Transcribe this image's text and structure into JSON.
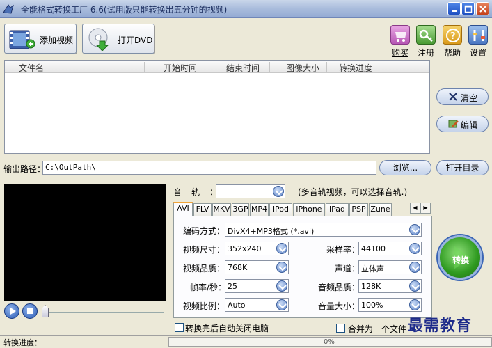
{
  "window": {
    "title": "全能格式转换工厂 6.6(试用版只能转换出五分钟的视频)"
  },
  "toolbar": {
    "add_video": "添加视频",
    "open_dvd": "打开DVD",
    "buy": "购买",
    "register": "注册",
    "help": "帮助",
    "settings": "设置"
  },
  "file_list": {
    "columns": [
      "文件名",
      "开始时间",
      "结束时间",
      "图像大小",
      "转换进度"
    ]
  },
  "side_buttons": {
    "clear": "清空",
    "edit": "编辑"
  },
  "output": {
    "label": "输出路径：",
    "path": "C:\\OutPath\\",
    "browse": "浏览...",
    "open_dir": "打开目录"
  },
  "audio": {
    "label": "音轨：",
    "value": "",
    "hint": "(多音轨视频，可以选择音轨.)"
  },
  "tabs": [
    "AVI",
    "FLV",
    "MKV",
    "3GP",
    "MP4",
    "iPod",
    "iPhone",
    "iPad",
    "PSP",
    "Zune"
  ],
  "settings": {
    "encoding_label": "编码方式：",
    "encoding_value": "DivX4+MP3格式 (*.avi)",
    "size_label": "视频尺寸：",
    "size_value": "352x240",
    "quality_label": "视频品质：",
    "quality_value": "768K",
    "fps_label": "帧率/秒：",
    "fps_value": "25",
    "ratio_label": "视频比例：",
    "ratio_value": "Auto",
    "samplerate_label": "采样率：",
    "samplerate_value": "44100",
    "channel_label": "声道：",
    "channel_value": "立体声",
    "audio_quality_label": "音频品质：",
    "audio_quality_value": "128K",
    "volume_label": "音量大小：",
    "volume_value": "100%"
  },
  "convert": "转换",
  "options": {
    "auto_shutdown": "转换完后自动关闭电脑",
    "merge": "合并为一个文件"
  },
  "status": {
    "label": "转换进度：",
    "progress": "0%"
  },
  "watermark": "最需教育",
  "colors": {
    "title_text": "#1b2d5e",
    "accent_blue": "#3b65b5",
    "convert_green": "#2f9a20"
  }
}
